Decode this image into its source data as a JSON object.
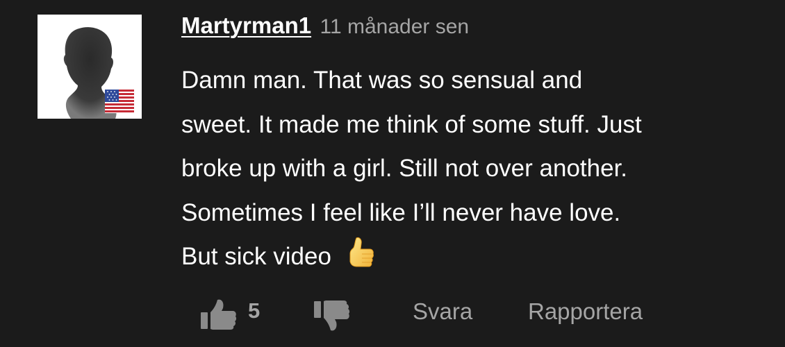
{
  "comment": {
    "username": "Martyrman1",
    "timestamp": "11 månader sen",
    "avatar_icon": "default-silhouette-avatar",
    "flag_icon": "us-flag-icon",
    "body_lines": [
      "Damn man. That was so sensual and",
      "sweet. It made me think of some stuff. Just",
      "broke up with a girl. Still not over another.",
      "Sometimes I feel like I’ll never have love.",
      "But sick video"
    ],
    "body_emoji": "thumbs-up-emoji"
  },
  "actions": {
    "like_icon": "thumbs-up-icon",
    "like_count": "5",
    "dislike_icon": "thumbs-down-icon",
    "reply_label": "Svara",
    "report_label": "Rapportera"
  },
  "colors": {
    "background": "#1b1b1b",
    "text": "#ffffff",
    "muted_text": "#a5a5a5"
  }
}
